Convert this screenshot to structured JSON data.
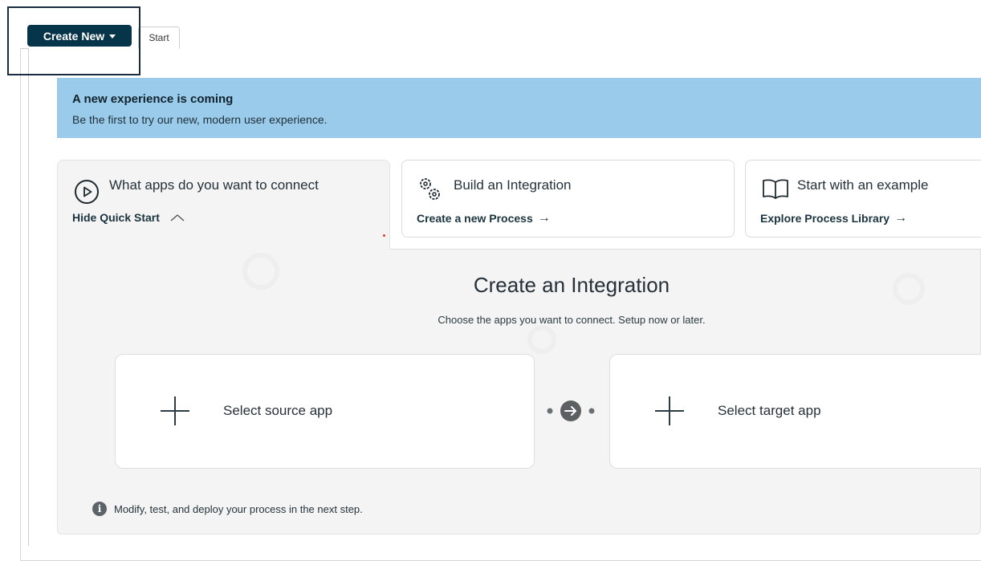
{
  "toolbar": {
    "create_new_label": "Create New"
  },
  "tabs": [
    {
      "label": "Start"
    }
  ],
  "banner": {
    "title": "A new experience is coming",
    "text": "Be the first to try our new, modern user experience."
  },
  "quick_start": {
    "connect_card": {
      "title": "What apps do you want to connect",
      "toggle_label": "Hide Quick Start",
      "icon": "play-circle-icon"
    },
    "build_card": {
      "title": "Build an Integration",
      "link_label": "Create a new Process",
      "icon": "gears-icon"
    },
    "example_card": {
      "title": "Start with an example",
      "link_label": "Explore Process Library",
      "icon": "book-icon"
    }
  },
  "integration": {
    "heading": "Create an Integration",
    "subtitle": "Choose the apps you want to connect. Setup now or later.",
    "source_label": "Select source app",
    "target_label": "Select target app",
    "footer_note": "Modify, test, and deploy your process in the next step."
  },
  "colors": {
    "primary": "#063549",
    "banner_bg": "#9bcbea",
    "panel_bg": "#f4f4f4"
  }
}
